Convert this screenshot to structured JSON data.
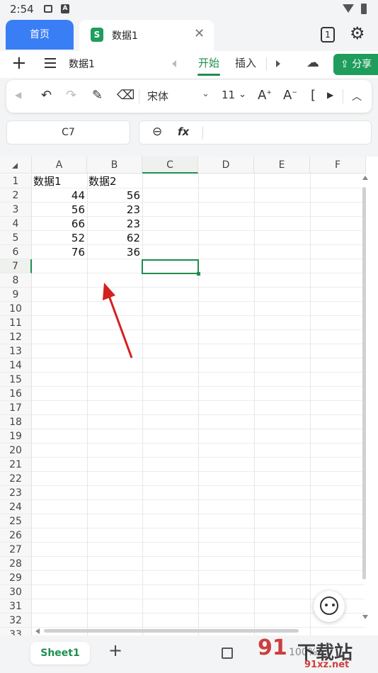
{
  "status_bar": {
    "time": "2:54",
    "notif_icon": "mail-icon",
    "app_icon": "A"
  },
  "tabs": {
    "home": "首页",
    "doc_title": "数据1",
    "window_count": "1"
  },
  "menu": {
    "file_name": "数据1",
    "tab_start": "开始",
    "tab_insert": "插入",
    "share": "分享"
  },
  "toolbar": {
    "font": "宋体",
    "size": "11"
  },
  "formula_bar": {
    "cell_ref": "C7",
    "fx": "fx",
    "value": ""
  },
  "grid": {
    "columns": [
      "A",
      "B",
      "C",
      "D",
      "E",
      "F"
    ],
    "rows": [
      "1",
      "2",
      "3",
      "4",
      "5",
      "6",
      "7",
      "8",
      "9",
      "10",
      "11",
      "12",
      "13",
      "14",
      "15",
      "16",
      "17",
      "18",
      "19",
      "20",
      "21",
      "22",
      "23",
      "24",
      "25",
      "26",
      "27",
      "28",
      "29",
      "30",
      "31",
      "32",
      "33"
    ],
    "cells": {
      "A1": "数据1",
      "B1": "数据2",
      "A2": "44",
      "B2": "56",
      "A3": "56",
      "B3": "23",
      "A4": "66",
      "B4": "23",
      "A5": "52",
      "B5": "62",
      "A6": "76",
      "B6": "36"
    },
    "selected_cell": "C7"
  },
  "bottom": {
    "sheet_tab": "Sheet1",
    "zoom": "100%"
  },
  "watermark": {
    "text1": "下载站",
    "text2": "91xz.net"
  },
  "colors": {
    "accent": "#1f8f4e",
    "home_tab": "#3a7ef5",
    "arrow": "#d42020"
  }
}
